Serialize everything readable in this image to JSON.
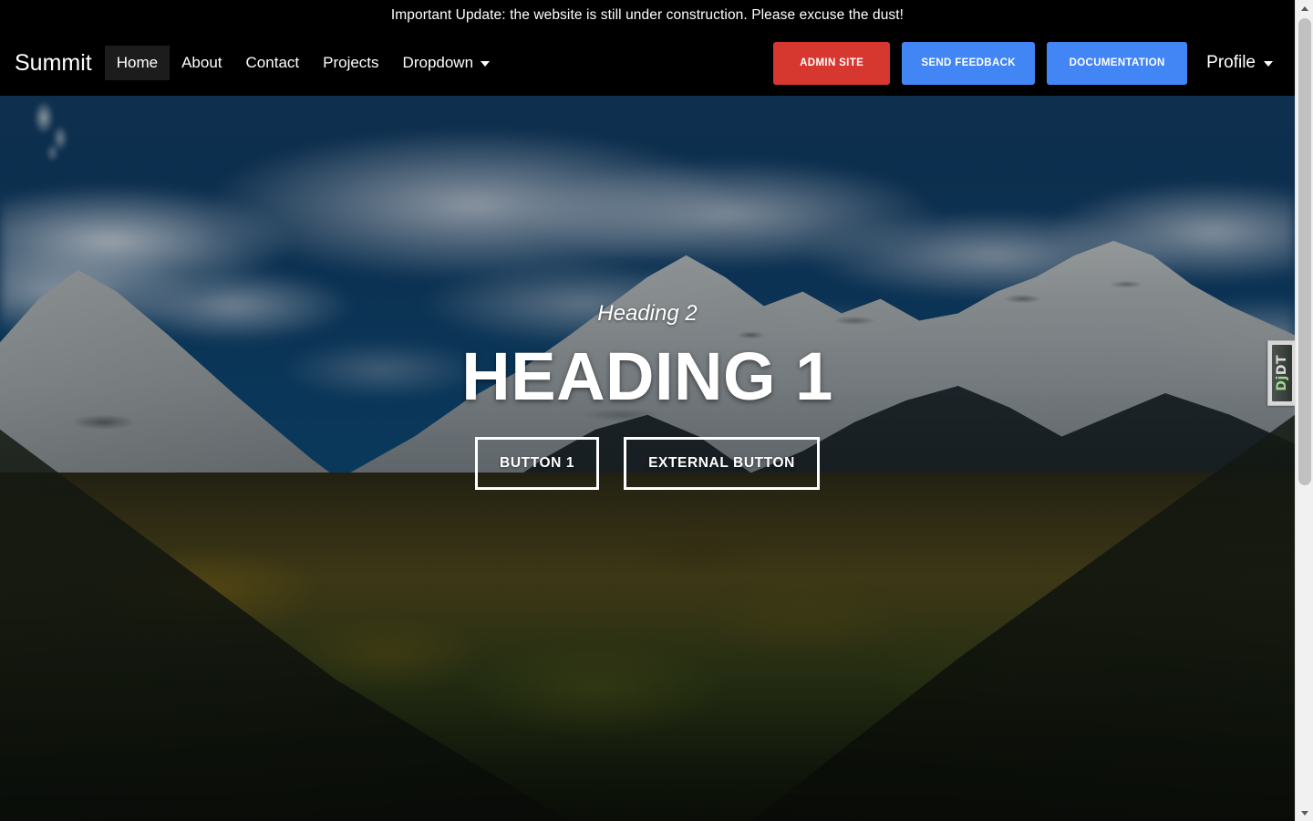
{
  "announcement": {
    "text": "Important Update: the website is still under construction. Please excuse the dust!"
  },
  "navbar": {
    "brand": "Summit",
    "links": [
      {
        "label": "Home",
        "active": true
      },
      {
        "label": "About",
        "active": false
      },
      {
        "label": "Contact",
        "active": false
      },
      {
        "label": "Projects",
        "active": false
      },
      {
        "label": "Dropdown",
        "active": false,
        "caret": true
      }
    ],
    "buttons": [
      {
        "label": "ADMIN SITE",
        "color": "#d6372f"
      },
      {
        "label": "SEND FEEDBACK",
        "color": "#4285f4"
      },
      {
        "label": "DOCUMENTATION",
        "color": "#4285f4"
      }
    ],
    "profile": {
      "label": "Profile",
      "caret_icon": "chevron-down-icon"
    },
    "background": "#000000",
    "active_item_background": "#1c1c1c"
  },
  "hero": {
    "subheading": "Heading 2",
    "heading": "HEADING 1",
    "buttons": [
      {
        "label": "BUTTON 1"
      },
      {
        "label": "EXTERNAL BUTTON"
      }
    ],
    "background_description": "snow-capped mountain range over an autumn valley under a blue cloudy sky"
  },
  "debug_toolbar": {
    "label_primary": "Dj",
    "label_secondary": "DT",
    "primary_color": "#9fd88f",
    "secondary_color": "#d9dbd8"
  },
  "scrollbar": {
    "up_arrow_icon": "triangle-up-icon",
    "down_arrow_icon": "triangle-down-icon"
  }
}
